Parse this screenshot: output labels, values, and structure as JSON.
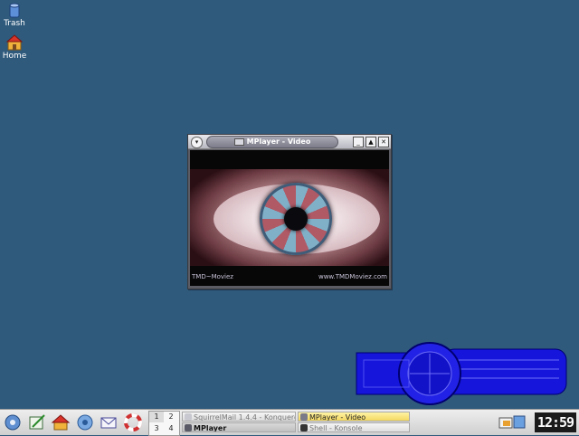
{
  "desktop": {
    "icons": [
      {
        "label": "Trash",
        "icon": "trash-icon"
      },
      {
        "label": "Home",
        "icon": "home-folder-icon"
      }
    ]
  },
  "window": {
    "title": "MPlayer - Video",
    "buttons": {
      "menu": "▾",
      "minimize": "_",
      "maximize": "▲",
      "close": "✕"
    },
    "video": {
      "caption_left": "TMD~Moviez",
      "caption_right": "www.TMDMoviez.com"
    }
  },
  "taskbar": {
    "launchers": [
      "kde-menu-icon",
      "editor-icon",
      "home-icon",
      "settings-icon",
      "mail-icon",
      "help-icon"
    ],
    "pager": [
      "1",
      "2",
      "3",
      "4"
    ],
    "tasks": [
      {
        "label": "SquirrelMail 1.4.4 - Konqueror",
        "state": "inactive"
      },
      {
        "label": "MPlayer - Video",
        "state": "active"
      },
      {
        "label": "MPlayer",
        "state": "pressed"
      },
      {
        "label": "Shell - Konsole",
        "state": "inactive"
      }
    ],
    "clock": "12:59"
  },
  "colors": {
    "desktop": "#2f5a7c",
    "active_task": "#f4d860",
    "widget_blue": "#1010e0"
  }
}
